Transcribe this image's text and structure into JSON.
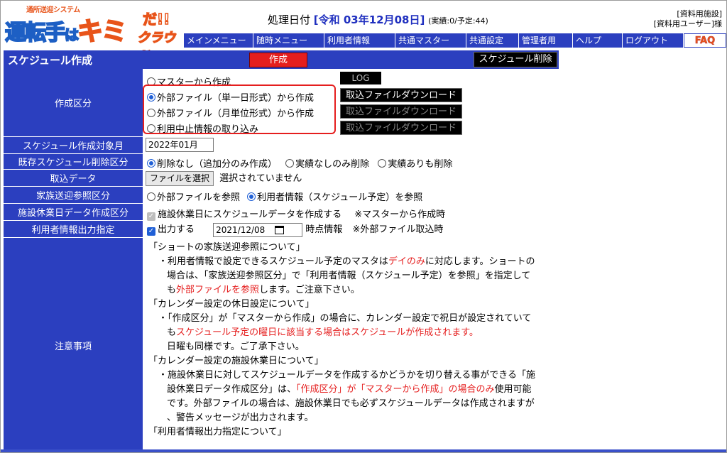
{
  "header": {
    "logo_sub": "通所送迎システム",
    "logo_main_1": "運転手",
    "logo_main_ha": "は",
    "logo_main_2": "キミ",
    "logo_da": "だ!!",
    "logo_cloud": "クラウド",
    "date_label": "処理日付",
    "date_value": "[令和 03年12月08日]",
    "counts": "(実績:0/予定:44)",
    "facility": "[資料用施設]",
    "user": "[資料用ユーザー]様"
  },
  "menu": [
    "メインメニュー",
    "随時メニュー",
    "利用者情報",
    "共通マスター",
    "共通設定",
    "管理者用",
    "ヘルプ",
    "ログアウト",
    "FAQ"
  ],
  "titlebar": {
    "title": "スケジュール作成",
    "create_label": "作成",
    "delete_label": "スケジュール削除"
  },
  "form": {
    "create_type": {
      "label": "作成区分",
      "options": [
        "マスターから作成",
        "外部ファイル（単一日形式）から作成",
        "外部ファイル（月単位形式）から作成",
        "利用中止情報の取り込み"
      ],
      "selected_index": 1,
      "log_label": "LOG",
      "download_label": "取込ファイルダウンロード"
    },
    "target_month": {
      "label": "スケジュール作成対象月",
      "value": "2022年01月"
    },
    "delete_type": {
      "label": "既存スケジュール削除区分",
      "options": [
        "削除なし（追加分のみ作成）",
        "実績なしのみ削除",
        "実績ありも削除"
      ],
      "selected_index": 0
    },
    "import_data": {
      "label": "取込データ",
      "button": "ファイルを選択",
      "status": "選択されていません"
    },
    "family_ref": {
      "label": "家族送迎参照区分",
      "options": [
        "外部ファイルを参照",
        "利用者情報（スケジュール予定）を参照"
      ],
      "selected_index": 1
    },
    "holiday_data": {
      "label": "施設休業日データ作成区分",
      "checkbox_label": "施設休業日にスケジュールデータを作成する",
      "note": "※マスターから作成時"
    },
    "user_output": {
      "label": "利用者情報出力指定",
      "checkbox_label": "出力する",
      "date_value": "2021/12/08",
      "suffix": "時点情報",
      "note": "※外部ファイル取込時"
    },
    "notes": {
      "label": "注意事項",
      "h1": "「ショートの家族送迎参照について」",
      "l1a": "・利用者情報で設定できるスケジュール予定のマスタは",
      "l1a_red": "デイのみ",
      "l1a_end": "に対応します。ショートの",
      "l1b": "場合は、「家族送迎参照区分」で「利用者情報（スケジュール予定）を参照」を指定して",
      "l1c_pre": "も",
      "l1c_red": "外部ファイルを参照",
      "l1c_end": "します。ご注意下さい。",
      "h2": "「カレンダー設定の休日設定について」",
      "l2a": "・「作成区分」が「マスターから作成」の場合に、カレンダー設定で祝日が設定されていて",
      "l2b_pre": "も",
      "l2b_red": "スケジュール予定の曜日に該当する場合はスケジュールが作成されます。",
      "l2c": "日曜も同様です。ご了承下さい。",
      "h3": "「カレンダー設定の施設休業日について」",
      "l3a": "・施設休業日に対してスケジュールデータを作成するかどうかを切り替える事ができる「施",
      "l3b_pre": "設休業日データ作成区分」は、",
      "l3b_red": "「作成区分」が「マスターから作成」の場合のみ",
      "l3b_end": "使用可能",
      "l3c": "です。外部ファイルの場合は、施設休業日でも必ずスケジュールデータは作成されますが",
      "l3d": "、警告メッセージが出力されます。",
      "h4": "「利用者情報出力指定について」"
    }
  },
  "colors": {
    "nav_blue": "#2b3fbf",
    "accent_red": "#e51e1e",
    "date_blue": "#1f2fbf"
  }
}
